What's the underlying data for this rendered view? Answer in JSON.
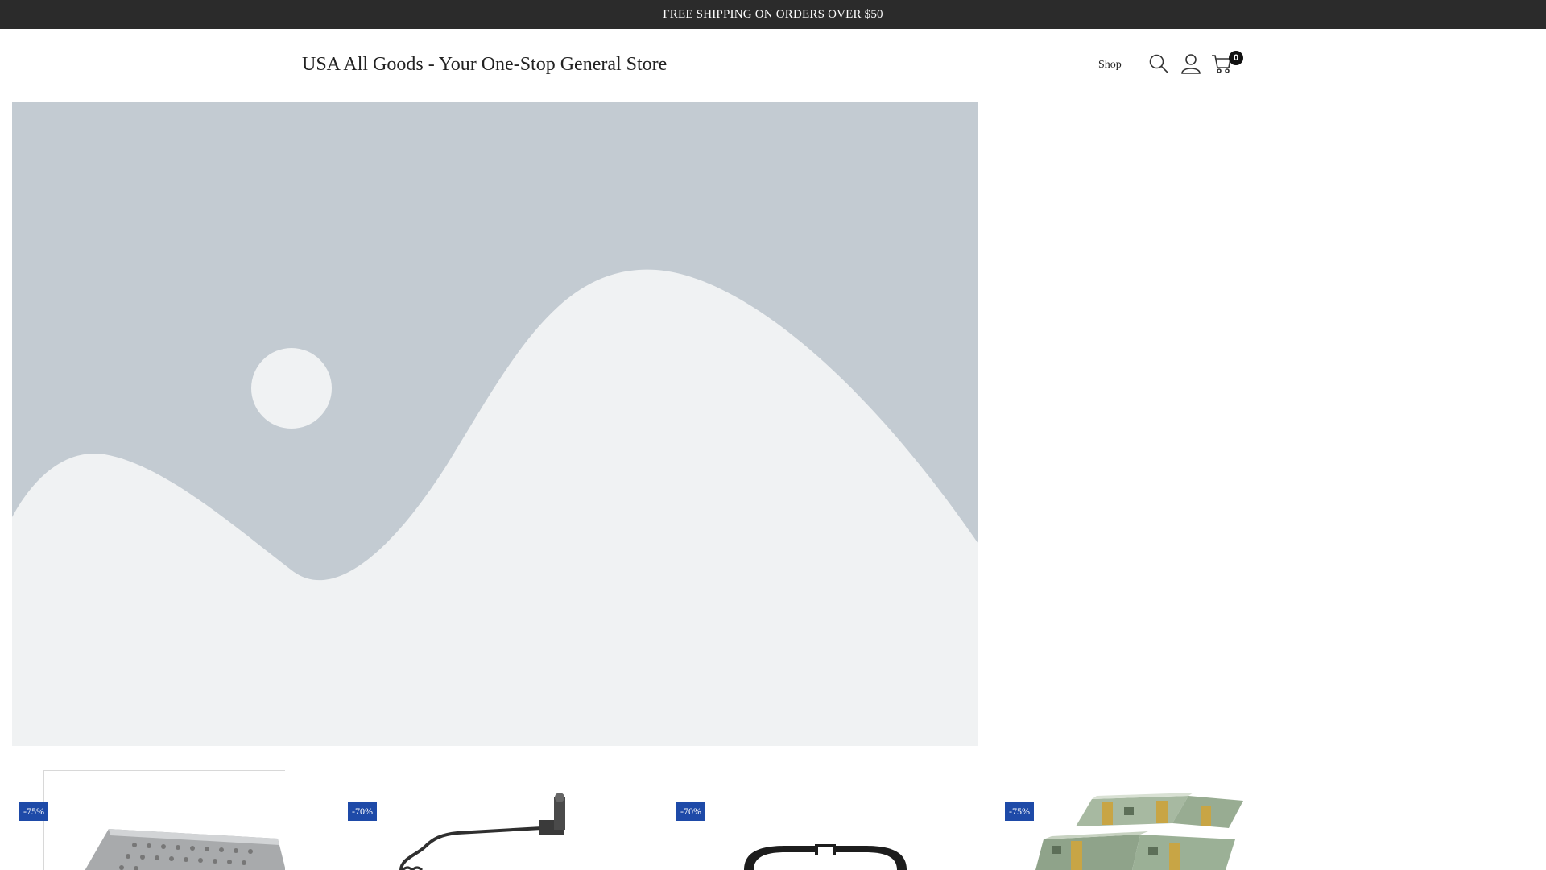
{
  "announcement": {
    "text": "FREE SHIPPING ON ORDERS OVER $50"
  },
  "header": {
    "site_title": "USA All Goods - Your One-Stop General Store",
    "nav": {
      "shop_label": "Shop"
    },
    "icons": {
      "search": "search-icon",
      "account": "user-icon",
      "cart": "cart-icon"
    },
    "cart_count": "0"
  },
  "hero": {
    "image": "placeholder-landscape-image"
  },
  "products": [
    {
      "discount": "-75%",
      "image": "metal-mounting-plate"
    },
    {
      "discount": "-70%",
      "image": "coiled-camera-cable"
    },
    {
      "discount": "-70%",
      "image": "black-rubber-eyecup"
    },
    {
      "discount": "-75%",
      "image": "stacks-of-dollar-bills"
    }
  ],
  "colors": {
    "announcement_bg": "#2b2b2b",
    "badge_bg": "#1e4aa8",
    "placeholder_bg": "#c3cbd2",
    "placeholder_fg": "#f0f2f3"
  }
}
